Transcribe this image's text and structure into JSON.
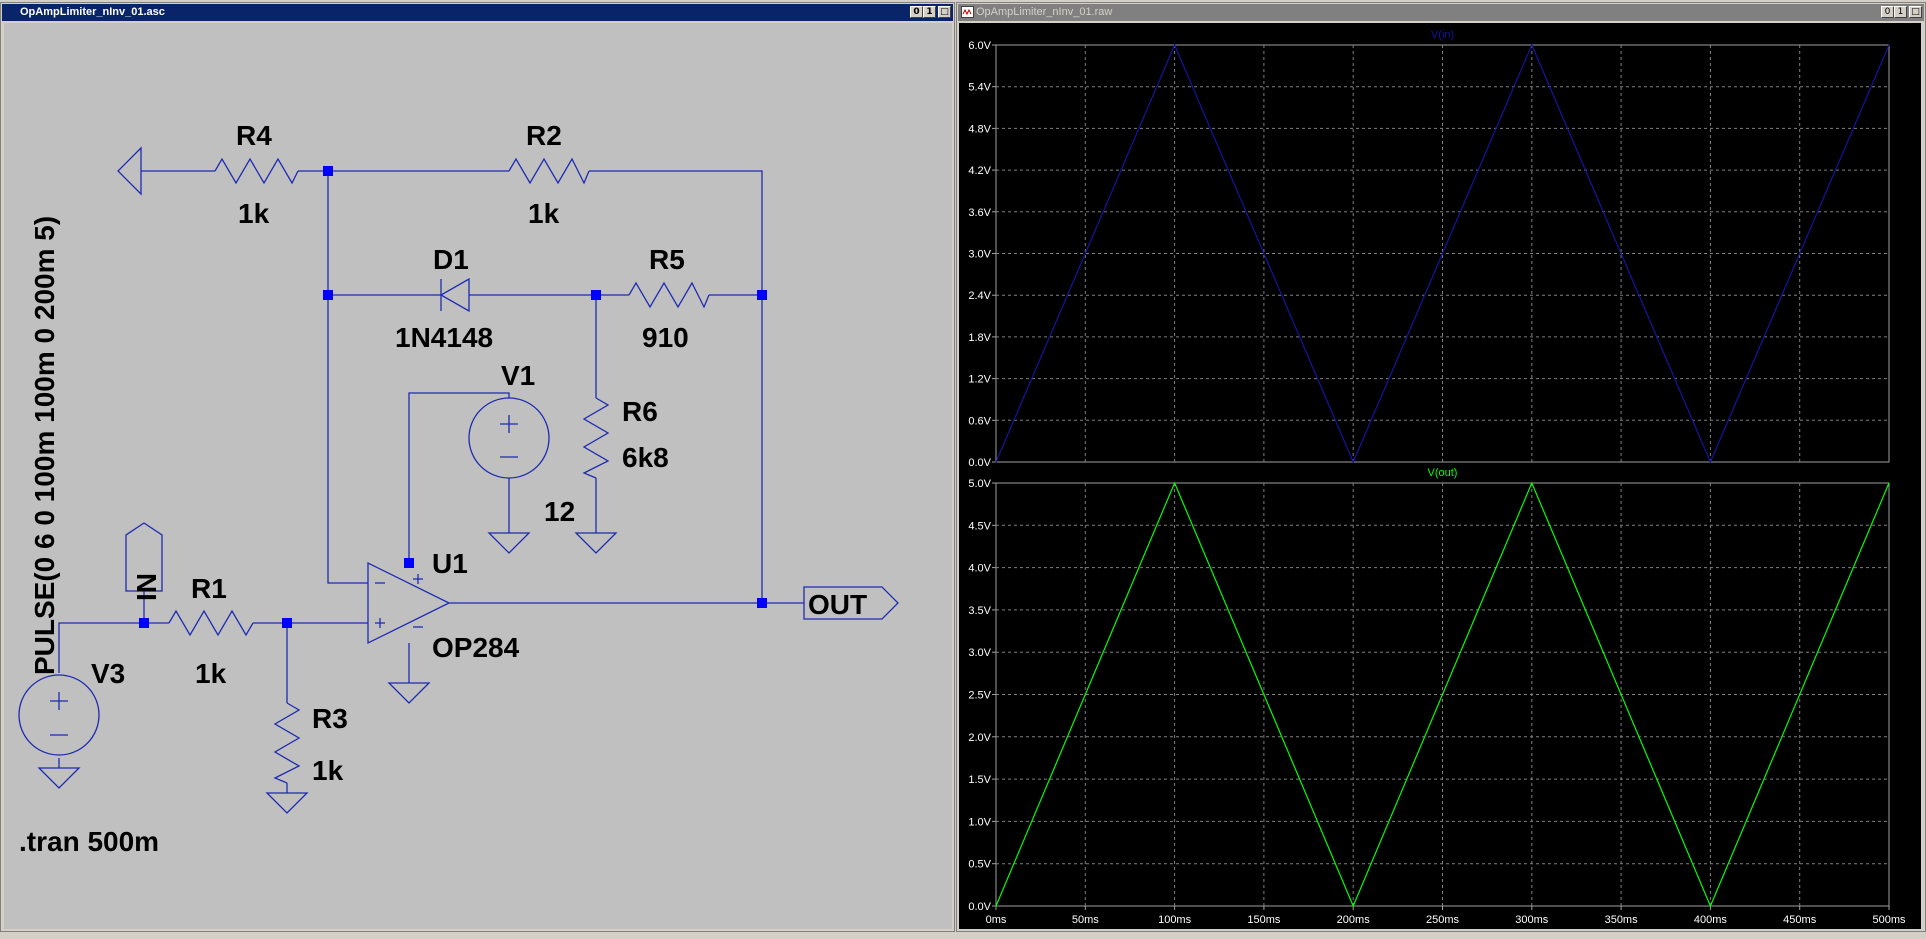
{
  "schematic_window": {
    "title": "OpAmpLimiter_nInv_01.asc",
    "buttons": [
      "0",
      "1",
      "□"
    ],
    "components": {
      "r4": {
        "name": "R4",
        "value": "1k"
      },
      "r2": {
        "name": "R2",
        "value": "1k"
      },
      "d1": {
        "name": "D1",
        "value": "1N4148"
      },
      "r5": {
        "name": "R5",
        "value": "910"
      },
      "v1": {
        "name": "V1",
        "value": "12"
      },
      "r6": {
        "name": "R6",
        "value": "6k8"
      },
      "u1": {
        "name": "U1",
        "value": "OP284"
      },
      "r1": {
        "name": "R1",
        "value": "1k"
      },
      "r3": {
        "name": "R3",
        "value": "1k"
      },
      "v3": {
        "name": "V3",
        "value": "PULSE(0 6 0 100m 100m 0 200m 5)"
      }
    },
    "labels": {
      "in": "IN",
      "out": "OUT"
    },
    "directive": ".tran 500m"
  },
  "waveform_window": {
    "title": "OpAmpLimiter_nInv_01.raw",
    "buttons": [
      "0",
      "1",
      "□"
    ]
  },
  "colors": {
    "schematic_bg": "#c0c0c0",
    "wire": "#1e2bb0",
    "junction": "#0000ff",
    "plot_bg": "#000000",
    "trace_in": "#1414a0",
    "trace_out": "#00ff00",
    "grid": "#808080",
    "axis_text": "#ffffff"
  },
  "chart_data": [
    {
      "type": "line",
      "title": "V(in)",
      "x": [
        0,
        100,
        200,
        300,
        400,
        500
      ],
      "series": [
        {
          "name": "V(in)",
          "values": [
            0,
            6,
            0,
            6,
            0,
            6
          ]
        }
      ],
      "xlim": [
        0,
        500
      ],
      "ylim": [
        0,
        6
      ],
      "yticks": [
        "0.0V",
        "0.6V",
        "1.2V",
        "1.8V",
        "2.4V",
        "3.0V",
        "3.6V",
        "4.2V",
        "4.8V",
        "5.4V",
        "6.0V"
      ],
      "ytick_values": [
        0,
        0.6,
        1.2,
        1.8,
        2.4,
        3.0,
        3.6,
        4.2,
        4.8,
        5.4,
        6.0
      ],
      "xticks": [],
      "grid": true
    },
    {
      "type": "line",
      "title": "V(out)",
      "x": [
        0,
        100,
        200,
        300,
        400,
        500
      ],
      "series": [
        {
          "name": "V(out)",
          "values": [
            0,
            5,
            0,
            5,
            0,
            5
          ]
        }
      ],
      "xlim": [
        0,
        500
      ],
      "ylim": [
        0,
        5
      ],
      "yticks": [
        "0.0V",
        "0.5V",
        "1.0V",
        "1.5V",
        "2.0V",
        "2.5V",
        "3.0V",
        "3.5V",
        "4.0V",
        "4.5V",
        "5.0V"
      ],
      "ytick_values": [
        0,
        0.5,
        1.0,
        1.5,
        2.0,
        2.5,
        3.0,
        3.5,
        4.0,
        4.5,
        5.0
      ],
      "xticks": [
        "0ms",
        "50ms",
        "100ms",
        "150ms",
        "200ms",
        "250ms",
        "300ms",
        "350ms",
        "400ms",
        "450ms",
        "500ms"
      ],
      "xtick_values": [
        0,
        50,
        100,
        150,
        200,
        250,
        300,
        350,
        400,
        450,
        500
      ],
      "grid": true
    }
  ]
}
